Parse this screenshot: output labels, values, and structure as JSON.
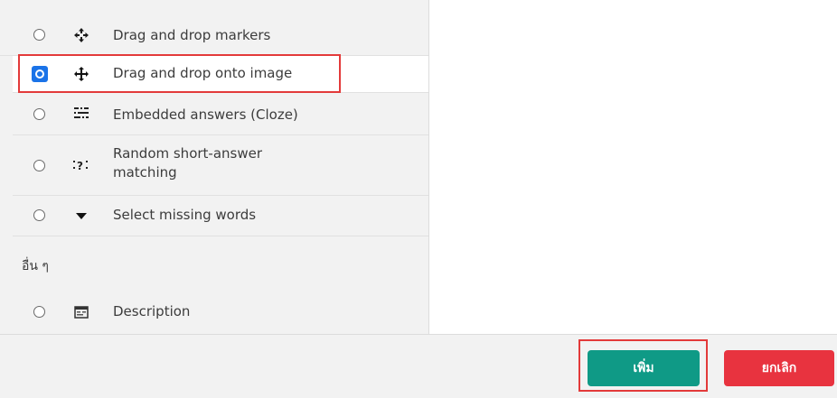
{
  "question_types": [
    {
      "label": "Drag and drop markers",
      "icon": "drag-markers-icon",
      "selected": false
    },
    {
      "label": "Drag and drop onto image",
      "icon": "move-cross-icon",
      "selected": true
    },
    {
      "label": "Embedded answers (Cloze)",
      "icon": "cloze-icon",
      "selected": false
    },
    {
      "label": "Random short-answer matching",
      "icon": "random-matching-icon",
      "selected": false
    },
    {
      "label": "Select missing words",
      "icon": "caret-down-icon",
      "selected": false
    }
  ],
  "other_section": {
    "title": "อื่น ๆ",
    "items": [
      {
        "label": "Description",
        "icon": "description-icon",
        "selected": false
      }
    ]
  },
  "footer": {
    "add_label": "เพิ่ม",
    "cancel_label": "ยกเลิก"
  },
  "colors": {
    "add_button": "#0f9a86",
    "cancel_button": "#e8333f",
    "selected_radio": "#1a73e8",
    "highlight": "#e33a3a"
  }
}
